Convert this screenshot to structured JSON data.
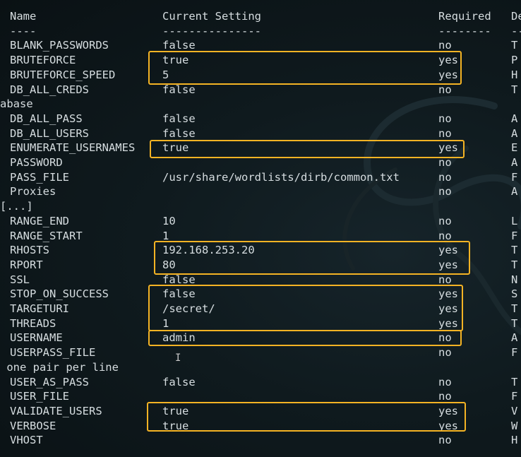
{
  "header": {
    "name": "Name",
    "setting": "Current Setting",
    "required": "Required",
    "description": "De"
  },
  "underline": {
    "name": "----",
    "setting": "---------------",
    "required": "--------",
    "description": "--"
  },
  "rows": [
    {
      "name": "BLANK_PASSWORDS",
      "setting": "false",
      "required": "no",
      "desc": "T"
    },
    {
      "name": "BRUTEFORCE",
      "setting": "true",
      "required": "yes",
      "desc": "P"
    },
    {
      "name": "BRUTEFORCE_SPEED",
      "setting": "5",
      "required": "yes",
      "desc": "H"
    },
    {
      "name": "DB_ALL_CREDS",
      "setting": "false",
      "required": "no",
      "desc": "T"
    },
    {
      "wrap": "abase"
    },
    {
      "name": "DB_ALL_PASS",
      "setting": "false",
      "required": "no",
      "desc": "A"
    },
    {
      "name": "DB_ALL_USERS",
      "setting": "false",
      "required": "no",
      "desc": "A"
    },
    {
      "name": "ENUMERATE_USERNAMES",
      "setting": "true",
      "required": "yes",
      "desc": "E"
    },
    {
      "name": "PASSWORD",
      "setting": "",
      "required": "no",
      "desc": "A"
    },
    {
      "name": "PASS_FILE",
      "setting": "/usr/share/wordlists/dirb/common.txt",
      "required": "no",
      "desc": "F"
    },
    {
      "name": "Proxies",
      "setting": "",
      "required": "no",
      "desc": "A"
    },
    {
      "wrap": "[...]"
    },
    {
      "name": "RANGE_END",
      "setting": "10",
      "required": "no",
      "desc": "L"
    },
    {
      "name": "RANGE_START",
      "setting": "1",
      "required": "no",
      "desc": "F"
    },
    {
      "name": "RHOSTS",
      "setting": "192.168.253.20",
      "required": "yes",
      "desc": "T"
    },
    {
      "name": "RPORT",
      "setting": "80",
      "required": "yes",
      "desc": "T"
    },
    {
      "name": "SSL",
      "setting": "false",
      "required": "no",
      "desc": "N"
    },
    {
      "name": "STOP_ON_SUCCESS",
      "setting": "false",
      "required": "yes",
      "desc": "S"
    },
    {
      "name": "TARGETURI",
      "setting": "/secret/",
      "required": "yes",
      "desc": "T"
    },
    {
      "name": "THREADS",
      "setting": "1",
      "required": "yes",
      "desc": "T"
    },
    {
      "name": "USERNAME",
      "setting": "admin",
      "required": "no",
      "desc": "A"
    },
    {
      "name": "USERPASS_FILE",
      "setting": "",
      "required": "no",
      "desc": "F"
    },
    {
      "wrap": " one pair per line"
    },
    {
      "name": "USER_AS_PASS",
      "setting": "false",
      "required": "no",
      "desc": "T"
    },
    {
      "name": "USER_FILE",
      "setting": "",
      "required": "no",
      "desc": "F"
    },
    {
      "name": "VALIDATE_USERS",
      "setting": "true",
      "required": "yes",
      "desc": "V"
    },
    {
      "name": "VERBOSE",
      "setting": "true",
      "required": "yes",
      "desc": "W"
    },
    {
      "name": "VHOST",
      "setting": "",
      "required": "no",
      "desc": "H"
    }
  ],
  "colors": {
    "background": "#0d1418",
    "text": "#d6dde0",
    "highlight": "#f4b324"
  },
  "icons": {
    "cursor": "text-cursor-icon",
    "logo": "kali-dragon-logo-icon"
  }
}
